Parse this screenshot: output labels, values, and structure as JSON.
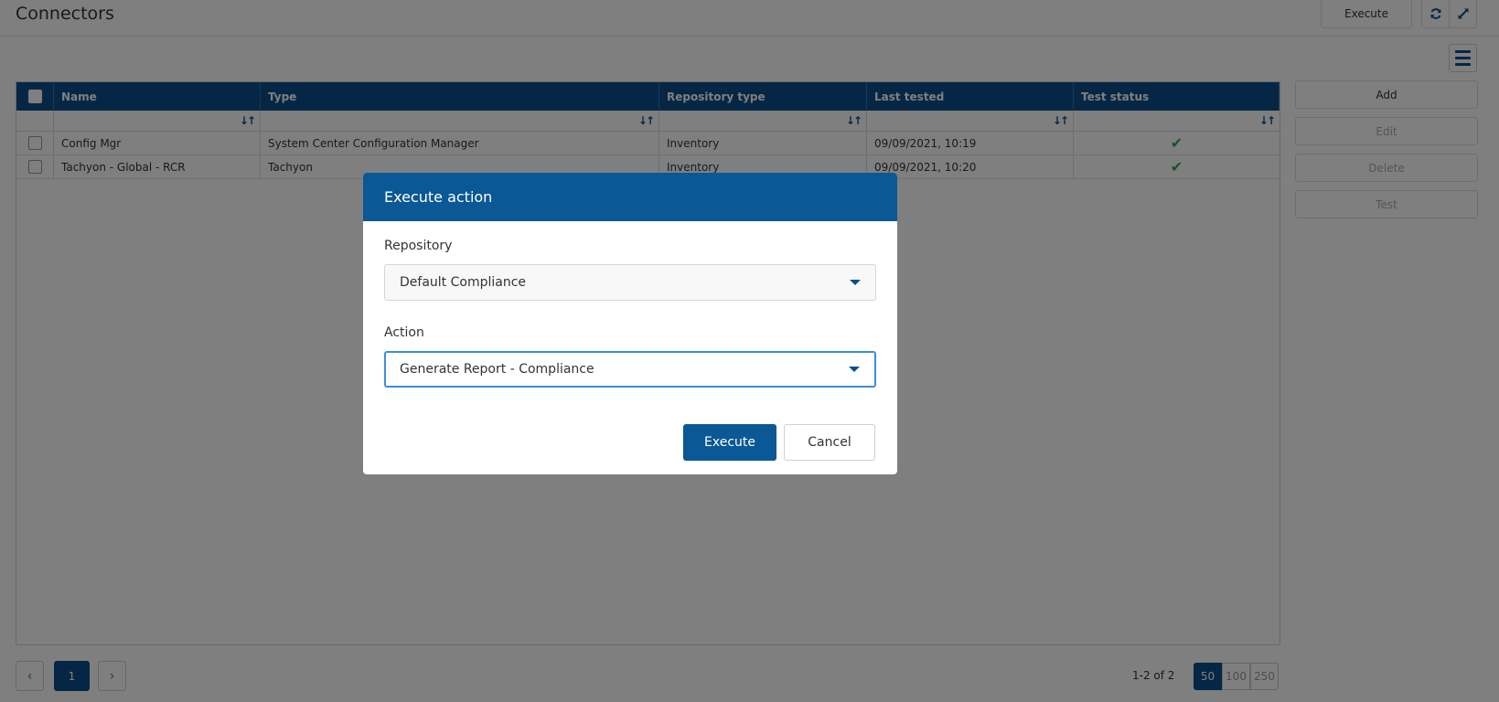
{
  "page": {
    "title": "Connectors"
  },
  "toolbar": {
    "execute_label": "Execute",
    "refresh_icon": "refresh-icon",
    "expand_icon": "expand-icon",
    "menu_icon": "hamburger-menu-icon"
  },
  "grid": {
    "columns": [
      "Name",
      "Type",
      "Repository type",
      "Last tested",
      "Test status"
    ],
    "rows": [
      {
        "name": "Config Mgr",
        "type": "System Center Configuration Manager",
        "repository_type": "Inventory",
        "last_tested": "09/09/2021, 10:19",
        "test_status": "passed"
      },
      {
        "name": "Tachyon - Global - RCR",
        "type": "Tachyon",
        "repository_type": "Inventory",
        "last_tested": "09/09/2021, 10:20",
        "test_status": "passed"
      }
    ]
  },
  "side_actions": [
    "Add",
    "Edit",
    "Delete",
    "Test"
  ],
  "pagination": {
    "current_page": "1",
    "info": "1-2 of 2",
    "page_sizes": [
      "50",
      "100",
      "250"
    ],
    "selected_page_size": "50"
  },
  "modal": {
    "title": "Execute action",
    "repository_label": "Repository",
    "repository_value": "Default Compliance",
    "action_label": "Action",
    "action_value": "Generate Report - Compliance",
    "execute_label": "Execute",
    "cancel_label": "Cancel"
  },
  "colors": {
    "primary": "#0a4f8a",
    "modal_header": "#0a5896",
    "success": "#2fa84f",
    "focus": "#3c8fd6"
  }
}
